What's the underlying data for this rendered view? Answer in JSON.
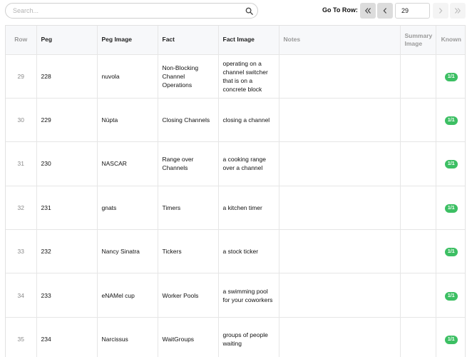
{
  "search": {
    "placeholder": "Search...",
    "value": ""
  },
  "pagination": {
    "goto_label": "Go To Row:",
    "row_value": "29"
  },
  "table": {
    "columns": [
      "Row",
      "Peg",
      "Peg Image",
      "Fact",
      "Fact Image",
      "Notes",
      "Summary Image",
      "Known"
    ],
    "rows": [
      {
        "row": "29",
        "peg": "228",
        "peg_image": "nuvola",
        "fact": "Non-Blocking Channel Operations",
        "fact_image": "operating on a channel switcher that is on a concrete block",
        "notes": "",
        "summary_image": "",
        "known": "1/1"
      },
      {
        "row": "30",
        "peg": "229",
        "peg_image": "Nüpta",
        "fact": "Closing Channels",
        "fact_image": "closing a channel",
        "notes": "",
        "summary_image": "",
        "known": "1/1"
      },
      {
        "row": "31",
        "peg": "230",
        "peg_image": "NASCAR",
        "fact": "Range over Channels",
        "fact_image": "a cooking range over a channel",
        "notes": "",
        "summary_image": "",
        "known": "1/1"
      },
      {
        "row": "32",
        "peg": "231",
        "peg_image": "gnats",
        "fact": "Timers",
        "fact_image": "a kitchen timer",
        "notes": "",
        "summary_image": "",
        "known": "1/1"
      },
      {
        "row": "33",
        "peg": "232",
        "peg_image": "Nancy Sinatra",
        "fact": "Tickers",
        "fact_image": "a stock ticker",
        "notes": "",
        "summary_image": "",
        "known": "1/1"
      },
      {
        "row": "34",
        "peg": "233",
        "peg_image": "eNAMel cup",
        "fact": "Worker Pools",
        "fact_image": "a swimming pool for your coworkers",
        "notes": "",
        "summary_image": "",
        "known": "1/1"
      },
      {
        "row": "35",
        "peg": "234",
        "peg_image": "Narcissus",
        "fact": "WaitGroups",
        "fact_image": "groups of people waiting",
        "notes": "",
        "summary_image": "",
        "known": "1/1"
      }
    ]
  },
  "colors": {
    "known_badge": "#3cbf63",
    "header_bg": "#f7f8fa"
  },
  "icons": [
    "search-icon",
    "first-page-icon",
    "prev-page-icon",
    "next-page-icon",
    "last-page-icon"
  ]
}
